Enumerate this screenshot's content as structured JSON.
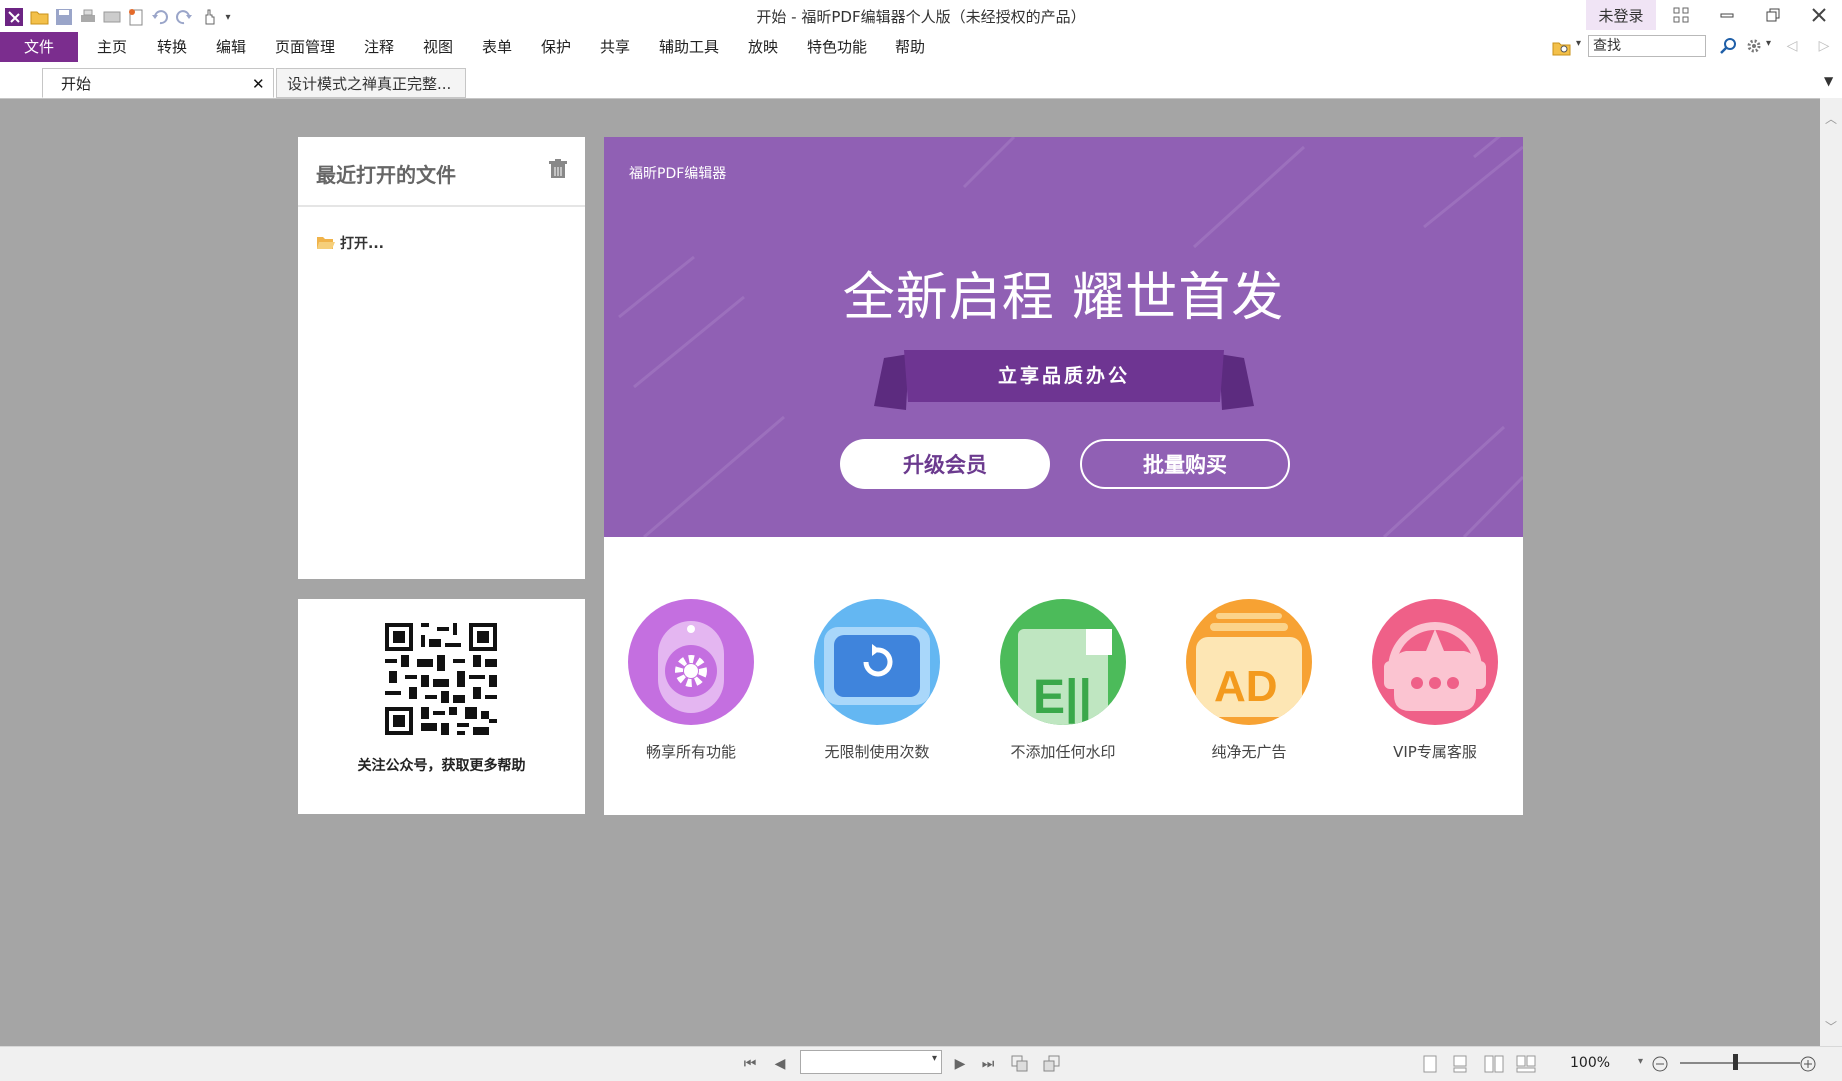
{
  "window": {
    "title": "开始 - 福昕PDF编辑器个人版（未经授权的产品）",
    "login_label": "未登录"
  },
  "menu": {
    "items": [
      "文件",
      "主页",
      "转换",
      "编辑",
      "页面管理",
      "注释",
      "视图",
      "表单",
      "保护",
      "共享",
      "辅助工具",
      "放映",
      "特色功能",
      "帮助"
    ]
  },
  "search": {
    "value": "查找"
  },
  "tabs": [
    {
      "label": "开始"
    },
    {
      "label": "设计模式之禅真正完整..."
    }
  ],
  "recent": {
    "title": "最近打开的文件",
    "open_label": "打开..."
  },
  "qr": {
    "caption": "关注公众号，获取更多帮助"
  },
  "promo": {
    "brand": "福昕PDF编辑器",
    "headline": "全新启程 耀世首发",
    "ribbon": "立享品质办公",
    "upgrade": "升级会员",
    "bulk": "批量购买"
  },
  "features": [
    {
      "label": "畅享所有功能",
      "icon": "gear-icon",
      "color": "#c46fe0"
    },
    {
      "label": "无限制使用次数",
      "icon": "refresh-icon",
      "color": "#4a9fe8"
    },
    {
      "label": "不添加任何水印",
      "icon": "stamp-icon",
      "color": "#4cbb5a"
    },
    {
      "label": "纯净无广告",
      "icon": "ad-icon",
      "color": "#f59a2a"
    },
    {
      "label": "VIP专属客服",
      "icon": "chat-icon",
      "color": "#ef6088"
    }
  ],
  "statusbar": {
    "zoom": "100%"
  },
  "colors": {
    "accent": "#7b2d8e",
    "promo": "#9060b4"
  }
}
